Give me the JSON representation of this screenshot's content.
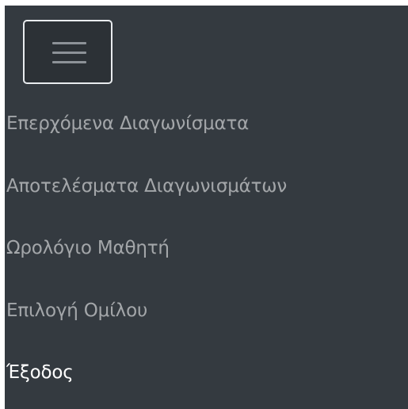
{
  "navbar": {
    "toggler_icon": "hamburger-menu-icon",
    "items": [
      {
        "label": "Επερχόμενα Διαγωνίσματα",
        "active": false
      },
      {
        "label": "Αποτελέσματα Διαγωνισμάτων",
        "active": false
      },
      {
        "label": "Ωρολόγιο Μαθητή",
        "active": false
      },
      {
        "label": "Επιλογή Ομίλου",
        "active": false
      },
      {
        "label": "Έξοδος",
        "active": true
      }
    ]
  },
  "colors": {
    "navbar_bg": "#343a40",
    "link": "#a4a7aa",
    "link_active": "#ffffff",
    "toggler_border": "#e9ecef"
  }
}
